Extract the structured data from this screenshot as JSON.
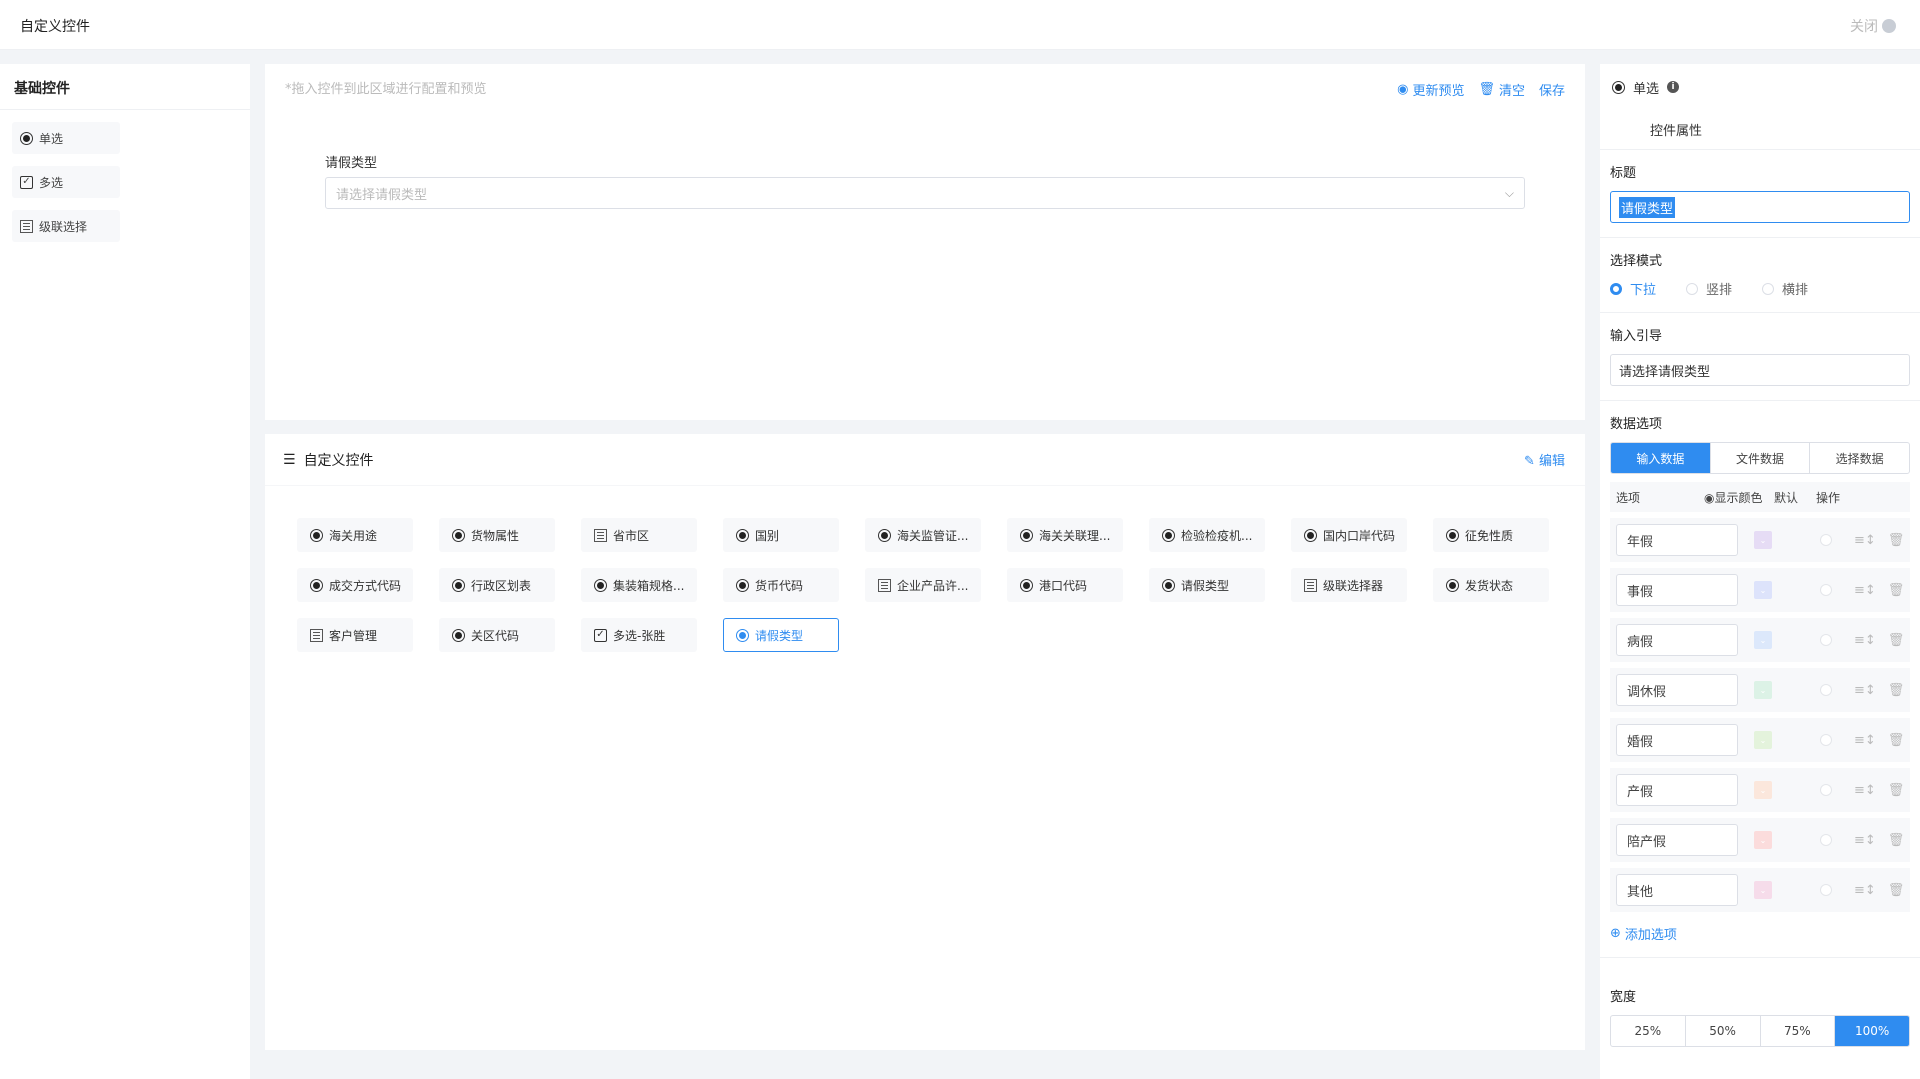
{
  "app": {
    "title": "自定义控件",
    "close_label": "关闭"
  },
  "left": {
    "header": "基础控件",
    "items": [
      {
        "label": "单选",
        "icon": "radio-icon"
      },
      {
        "label": "多选",
        "icon": "checkbox-icon"
      },
      {
        "label": "级联选择",
        "icon": "cascade-icon"
      }
    ]
  },
  "preview": {
    "hint": "*拖入控件到此区域进行配置和预览",
    "actions": {
      "refresh": "更新预览",
      "clear": "清空",
      "save": "保存"
    },
    "field_label": "请假类型",
    "field_placeholder": "请选择请假类型"
  },
  "custom": {
    "title": "自定义控件",
    "edit": "编辑",
    "items": [
      {
        "label": "海关用途",
        "icon": "radio"
      },
      {
        "label": "货物属性",
        "icon": "radio"
      },
      {
        "label": "省市区",
        "icon": "cascade"
      },
      {
        "label": "国别",
        "icon": "radio"
      },
      {
        "label": "海关监管证...",
        "icon": "radio"
      },
      {
        "label": "海关关联理...",
        "icon": "radio"
      },
      {
        "label": "检验检疫机...",
        "icon": "radio"
      },
      {
        "label": "国内口岸代码",
        "icon": "radio"
      },
      {
        "label": "征免性质",
        "icon": "radio"
      },
      {
        "label": "成交方式代码",
        "icon": "radio"
      },
      {
        "label": "行政区划表",
        "icon": "radio"
      },
      {
        "label": "集装箱规格...",
        "icon": "radio"
      },
      {
        "label": "货币代码",
        "icon": "radio"
      },
      {
        "label": "企业产品许...",
        "icon": "cascade"
      },
      {
        "label": "港口代码",
        "icon": "radio"
      },
      {
        "label": "请假类型",
        "icon": "radio"
      },
      {
        "label": "级联选择器",
        "icon": "cascade"
      },
      {
        "label": "发货状态",
        "icon": "radio"
      },
      {
        "label": "客户管理",
        "icon": "cascade"
      },
      {
        "label": "关区代码",
        "icon": "radio"
      },
      {
        "label": "多选-张胜",
        "icon": "check"
      },
      {
        "label": "请假类型",
        "icon": "radio",
        "selected": true
      }
    ]
  },
  "props": {
    "type_label": "单选",
    "tab": "控件属性",
    "title_label": "标题",
    "title_value": "请假类型",
    "mode_label": "选择模式",
    "modes": [
      "下拉",
      "竖排",
      "横排"
    ],
    "mode_selected": "下拉",
    "guide_label": "输入引导",
    "guide_value": "请选择请假类型",
    "data_label": "数据选项",
    "data_tabs": [
      "输入数据",
      "文件数据",
      "选择数据"
    ],
    "data_tab_selected": "输入数据",
    "columns": [
      "选项",
      "显示颜色",
      "默认",
      "操作"
    ],
    "options": [
      {
        "label": "年假",
        "color": "#e6dcf5"
      },
      {
        "label": "事假",
        "color": "#dde3fb"
      },
      {
        "label": "病假",
        "color": "#dce8fb"
      },
      {
        "label": "调休假",
        "color": "#dcf2e6"
      },
      {
        "label": "婚假",
        "color": "#e4f3dc"
      },
      {
        "label": "产假",
        "color": "#fbe7dc"
      },
      {
        "label": "陪产假",
        "color": "#fbdcdc"
      },
      {
        "label": "其他",
        "color": "#f6dcea"
      }
    ],
    "add_option": "添加选项",
    "width_label": "宽度",
    "widths": [
      "25%",
      "50%",
      "75%",
      "100%"
    ],
    "width_selected": "100%"
  }
}
